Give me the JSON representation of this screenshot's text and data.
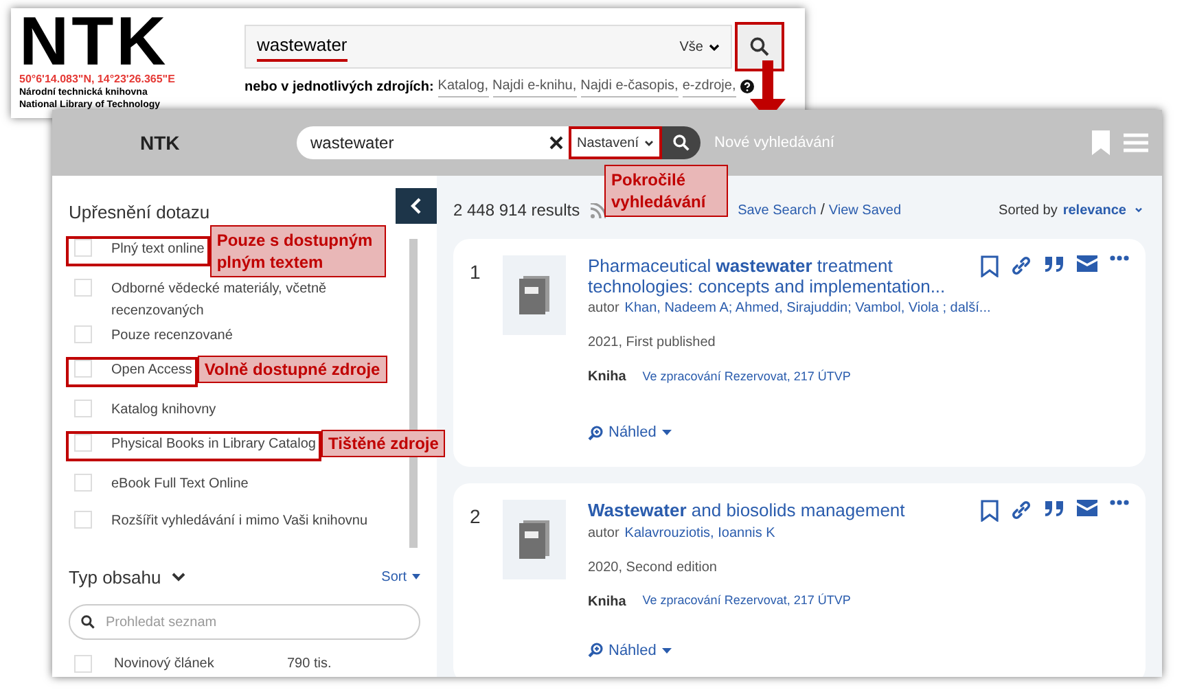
{
  "top_search": {
    "logo": "NTK",
    "coordinates": "50°6'14.083\"N, 14°23'26.365\"E",
    "library_name_cs": "Národní technická knihovna",
    "library_name_en": "National Library of Technology",
    "query": "wastewater",
    "query_highlighted": true,
    "scope": "Vše",
    "search_button_highlighted": true,
    "sources_label": "nebo v jednotlivých zdrojích:",
    "sources": [
      "Katalog,",
      "Najdi e-knihu,",
      "Najdi e-časopis,",
      "e-zdroje,"
    ]
  },
  "header": {
    "logo": "NTK",
    "query": "wastewater",
    "settings": {
      "label": "Nastavení",
      "highlighted": true,
      "callout": "Pokročilé vyhledávání"
    },
    "new_search": "Nové vyhledávání"
  },
  "sidebar": {
    "title": "Upřesnění dotazu",
    "facets": [
      {
        "label": "Plný text online",
        "checked": false,
        "highlighted": true,
        "callout": "Pouze s dostupným plným textem"
      },
      {
        "label": "Odborné vědecké materiály, včetně recenzovaných",
        "checked": false,
        "highlighted": false
      },
      {
        "label": "Pouze recenzované",
        "checked": false,
        "highlighted": false
      },
      {
        "label": "Open Access",
        "checked": false,
        "highlighted": true,
        "callout": "Volně dostupné zdroje"
      },
      {
        "label": "Katalog knihovny",
        "checked": false,
        "highlighted": false
      },
      {
        "label": "Physical Books in Library Catalog",
        "checked": false,
        "highlighted": true,
        "callout": "Tištěné zdroje"
      },
      {
        "label": "eBook Full Text Online",
        "checked": false,
        "highlighted": false
      },
      {
        "label": "Rozšířit vyhledávání i mimo Vaši knihovnu",
        "checked": false,
        "highlighted": false
      }
    ],
    "content_type": {
      "title": "Typ obsahu",
      "sort": "Sort",
      "search_placeholder": "Prohledat seznam",
      "items": [
        {
          "label": "Novinový článek",
          "count": "790 tis.",
          "checked": false
        }
      ]
    }
  },
  "results_bar": {
    "count": "2 448 914 results",
    "save_search": "Save Search",
    "separator": "/",
    "view_saved": "View Saved",
    "sorted_by": "Sorted by",
    "sort_value": "relevance"
  },
  "results": [
    {
      "number": "1",
      "title": "Pharmaceutical **wastewater** treatment technologies: concepts and implementation...",
      "author_label": "autor",
      "authors": "Khan, Nadeem A; Ahmed, Sirajuddin; Vambol, Viola ; další...",
      "edition": "2021, First published",
      "format": "Kniha",
      "availability": "Ve zpracování Rezervovat, 217 ÚTVP",
      "preview": "Náhled"
    },
    {
      "number": "2",
      "title": "**Wastewater** and biosolids management",
      "author_label": "autor",
      "authors": "Kalavrouziotis, Ioannis K",
      "edition": "2020, Second edition",
      "format": "Kniha",
      "availability": "Ve zpracování Rezervovat, 217 ÚTVP",
      "preview": "Náhled"
    }
  ]
}
